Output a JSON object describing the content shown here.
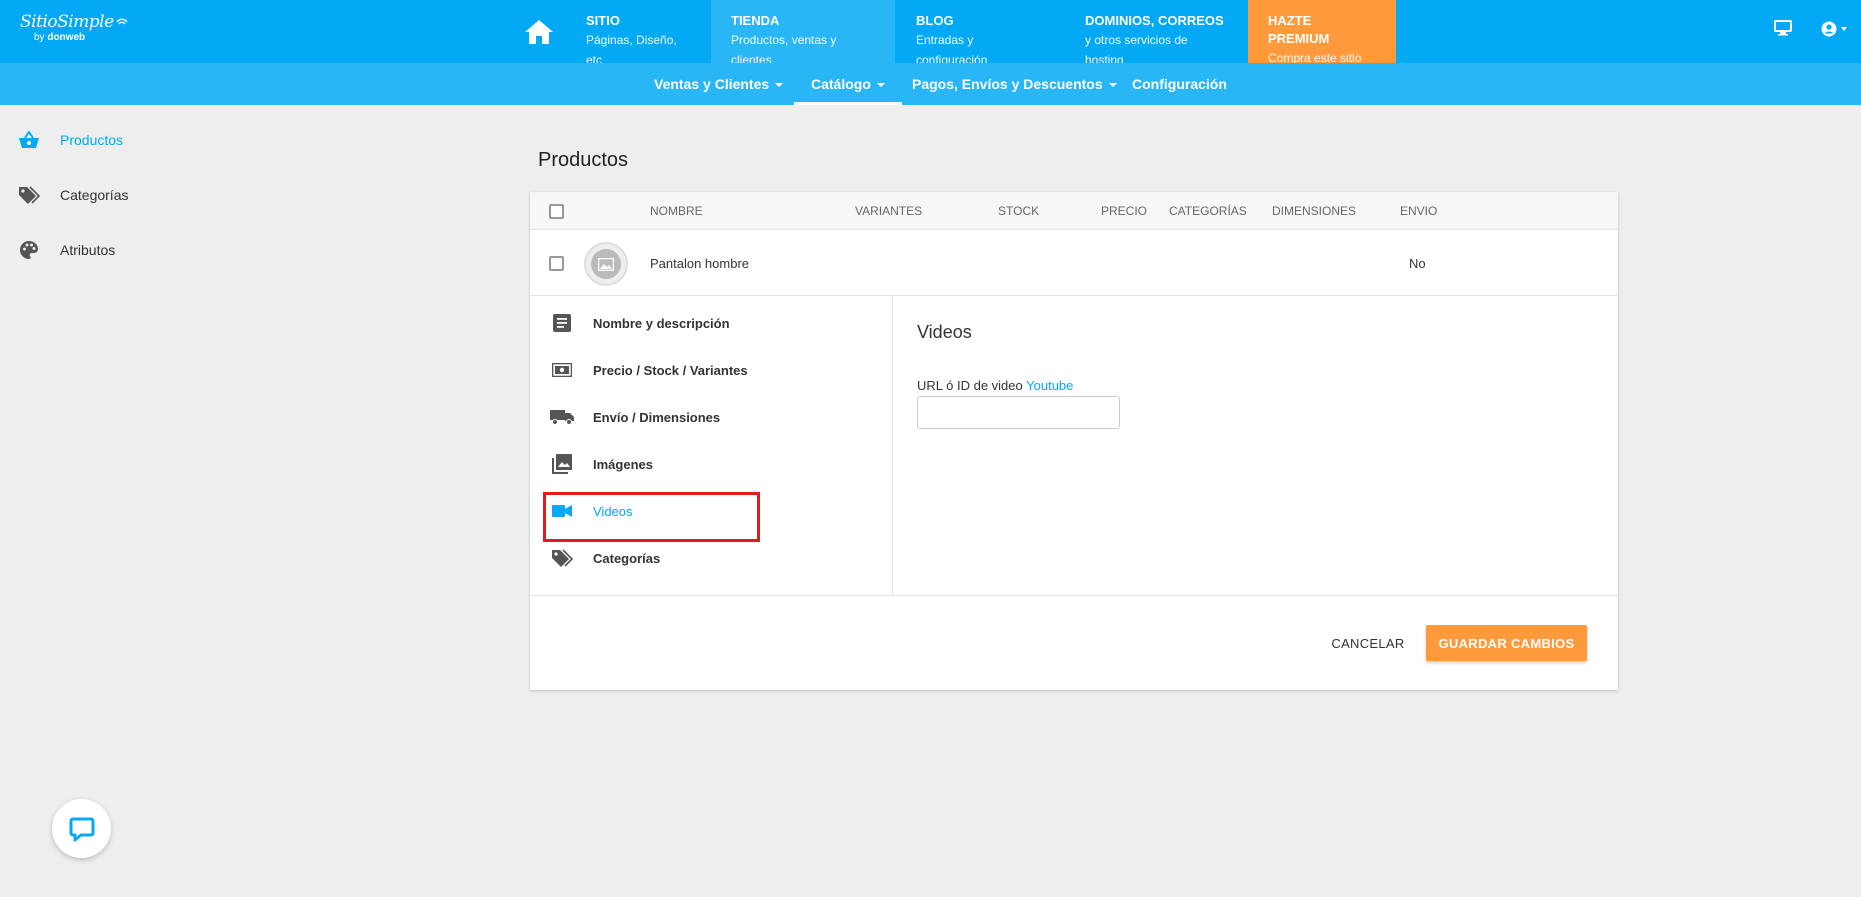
{
  "brand": {
    "name": "SitioSimple",
    "by_prefix": "by",
    "by_name": "donweb"
  },
  "topnav": {
    "home_icon": "home-icon",
    "items": [
      {
        "title": "SITIO",
        "subtitle": "Páginas, Diseño, etc"
      },
      {
        "title": "TIENDA",
        "subtitle": "Productos, ventas y clientes"
      },
      {
        "title": "BLOG",
        "subtitle": "Entradas y configuración"
      },
      {
        "title": "DOMINIOS, CORREOS",
        "subtitle": "y otros servicios de hosting"
      },
      {
        "title": "HAZTE PREMIUM",
        "subtitle": "Compra este sitio"
      }
    ],
    "right_icons": [
      "monitor-icon",
      "account-icon"
    ]
  },
  "subnav": {
    "items": [
      {
        "label": "Ventas y Clientes"
      },
      {
        "label": "Catálogo"
      },
      {
        "label": "Pagos, Envíos y Descuentos"
      },
      {
        "label": "Configuración"
      }
    ]
  },
  "sidebar": {
    "items": [
      {
        "label": "Productos",
        "icon": "basket-icon"
      },
      {
        "label": "Categorías",
        "icon": "tags-icon"
      },
      {
        "label": "Atributos",
        "icon": "palette-icon"
      }
    ]
  },
  "page": {
    "title": "Productos"
  },
  "table": {
    "headers": [
      "NOMBRE",
      "VARIANTES",
      "STOCK",
      "PRECIO",
      "CATEGORÍAS",
      "DIMENSIONES",
      "ENVIO"
    ],
    "rows": [
      {
        "name": "Pantalon hombre",
        "envio": "No"
      }
    ]
  },
  "editor": {
    "tabs": [
      {
        "label": "Nombre y descripción",
        "icon": "document-icon"
      },
      {
        "label": "Precio / Stock / Variantes",
        "icon": "money-icon"
      },
      {
        "label": "Envío / Dimensiones",
        "icon": "truck-icon"
      },
      {
        "label": "Imágenes",
        "icon": "images-icon"
      },
      {
        "label": "Videos",
        "icon": "video-icon"
      },
      {
        "label": "Categorías",
        "icon": "tags-icon"
      }
    ],
    "panel": {
      "title": "Videos",
      "field_label": "URL ó ID de video",
      "field_link": "Youtube",
      "field_value": ""
    }
  },
  "actions": {
    "cancel": "CANCELAR",
    "save": "GUARDAR CAMBIOS"
  },
  "colors": {
    "primary": "#03a9f4",
    "subbar": "#29b6f6",
    "accent": "#ff9a3c",
    "highlight": "#e01c1c"
  }
}
